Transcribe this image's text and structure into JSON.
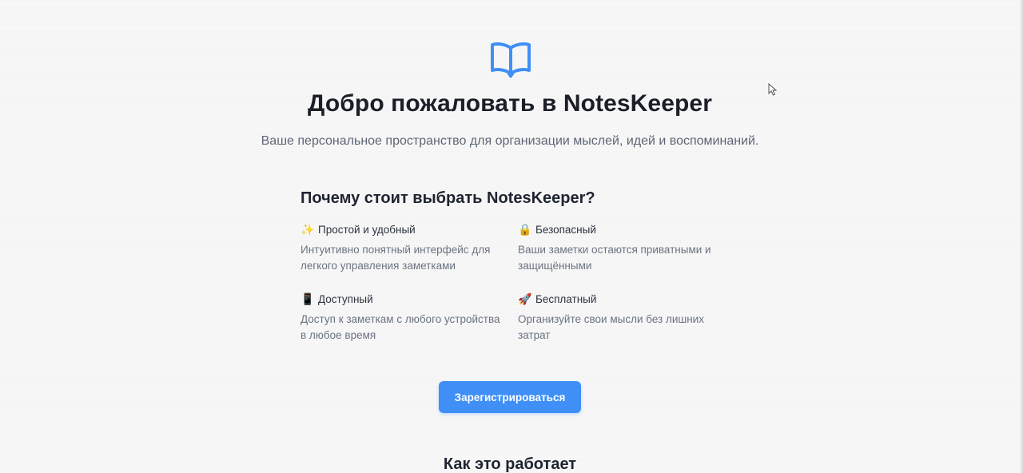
{
  "colors": {
    "accent": "#3f8ff6",
    "text": "#1b1f27",
    "muted": "#6b7380",
    "background": "#f7f7f8"
  },
  "hero": {
    "icon": "open-book-icon",
    "title": "Добро пожаловать в NotesKeeper",
    "subtitle": "Ваше персональное пространство для организации мыслей, идей и воспоминаний."
  },
  "why": {
    "title": "Почему стоит выбрать NotesKeeper?",
    "features": [
      {
        "icon": "sparkles-icon",
        "glyph": "✨",
        "title": "Простой и удобный",
        "desc": "Интуитивно понятный интерфейс для легкого управления заметками"
      },
      {
        "icon": "lock-icon",
        "glyph": "🔒",
        "title": "Безопасный",
        "desc": "Ваши заметки остаются приватными и защищёнными"
      },
      {
        "icon": "phone-icon",
        "glyph": "📱",
        "title": "Доступный",
        "desc": "Доступ к заметкам с любого устройства в любое время"
      },
      {
        "icon": "rocket-icon",
        "glyph": "🚀",
        "title": "Бесплатный",
        "desc": "Организуйте свои мысли без лишних затрат"
      }
    ]
  },
  "cta": {
    "label": "Зарегистрироваться"
  },
  "how": {
    "title": "Как это работает"
  }
}
